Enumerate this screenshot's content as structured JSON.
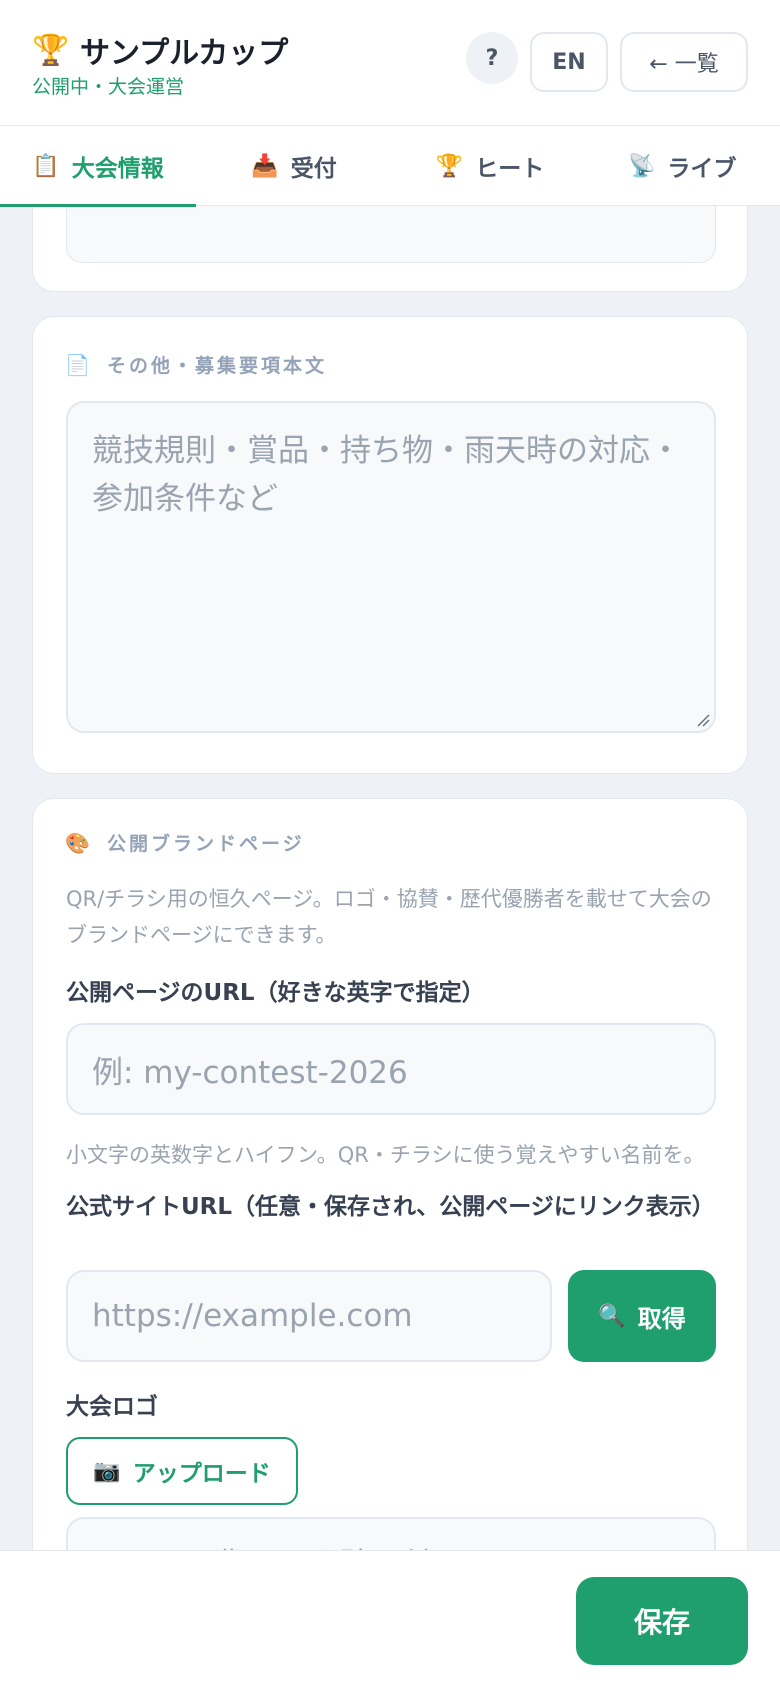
{
  "header": {
    "trophy_icon": "🏆",
    "title": "サンプルカップ",
    "subtitle": "公開中・大会運営",
    "help_label": "?",
    "lang_label": "EN",
    "back_label": "← 一覧"
  },
  "tabs": [
    {
      "icon": "📋",
      "label": "大会情報",
      "active": true
    },
    {
      "icon": "📥",
      "label": "受付"
    },
    {
      "icon": "🏆",
      "label": "ヒート"
    },
    {
      "icon": "📡",
      "label": "ライブ"
    }
  ],
  "other_section": {
    "icon": "📄",
    "heading": "その他・募集要項本文",
    "placeholder": "競技規則・賞品・持ち物・雨天時の対応・参加条件など"
  },
  "brand_section": {
    "icon": "🎨",
    "heading": "公開ブランドページ",
    "description": "QR/チラシ用の恒久ページ。ロゴ・協賛・歴代優勝者を載せて大会のブランドページにできます。",
    "public_url_label": "公開ページのURL（好きな英字で指定）",
    "public_url_placeholder": "例: my-contest-2026",
    "public_url_hint": "小文字の英数字とハイフン。QR・チラシに使う覚えやすい名前を。",
    "site_url_label": "公式サイトURL（任意・保存され、公開ページにリンク表示）",
    "site_url_placeholder": "https://example.com",
    "fetch_icon": "🔍",
    "fetch_label": "取得",
    "logo_label": "大会ロゴ",
    "upload_icon": "📷",
    "upload_label": "アップロード",
    "logo_url_placeholder": "または画像URLを貼り付け"
  },
  "footer": {
    "save_label": "保存"
  },
  "colors": {
    "accent": "#1f9e6e",
    "background": "#eef2f6",
    "muted": "#94a3b8"
  }
}
